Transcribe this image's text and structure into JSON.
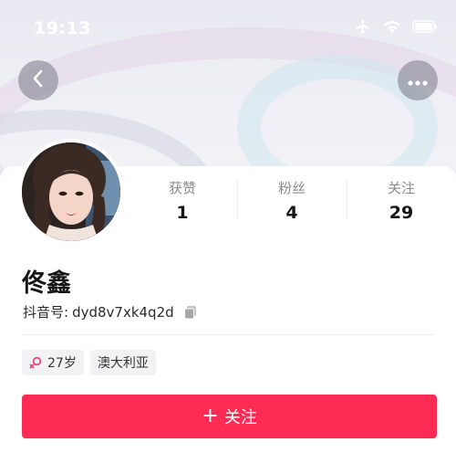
{
  "status_bar": {
    "time": "19:13",
    "icons": [
      "airplane-icon",
      "wifi-icon",
      "battery-icon"
    ]
  },
  "nav": {
    "back_icon": "chevron-left-icon",
    "more_icon": "ellipsis-icon"
  },
  "profile": {
    "name": "佟鑫",
    "douyin_id_label": "抖音号:",
    "douyin_id": "dyd8v7xk4q2d"
  },
  "stats": [
    {
      "label": "获赞",
      "value": "1"
    },
    {
      "label": "粉丝",
      "value": "4"
    },
    {
      "label": "关注",
      "value": "29"
    }
  ],
  "tags": {
    "age": "27岁",
    "location": "澳大利亚"
  },
  "follow_button": {
    "plus": "+",
    "label": "关注"
  },
  "colors": {
    "accent": "#fe2c55",
    "gender": "#e64a7a"
  }
}
